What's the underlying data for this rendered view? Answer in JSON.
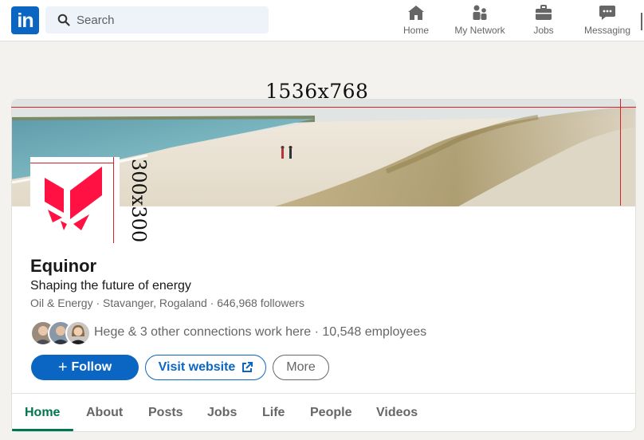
{
  "nav": {
    "logo_text": "in",
    "search_placeholder": "Search",
    "items": [
      {
        "label": "Home",
        "icon": "home-icon"
      },
      {
        "label": "My Network",
        "icon": "network-icon"
      },
      {
        "label": "Jobs",
        "icon": "briefcase-icon"
      },
      {
        "label": "Messaging",
        "icon": "messaging-icon"
      }
    ]
  },
  "annotations": {
    "banner_size": "1536x768",
    "logo_size": "300x300"
  },
  "company": {
    "name": "Equinor",
    "tagline": "Shaping the future of energy",
    "meta": "Oil & Energy · Stavanger, Rogaland · 646,968 followers",
    "connections": "Hege & 3 other connections work here · 10,548 employees"
  },
  "actions": {
    "follow_label": "Follow",
    "website_label": "Visit website",
    "more_label": "More"
  },
  "tabs": [
    "Home",
    "About",
    "Posts",
    "Jobs",
    "Life",
    "People",
    "Videos"
  ],
  "colors": {
    "brand_blue": "#0a66c2",
    "tab_active_green": "#01754f",
    "equinor_red": "#ff1243",
    "annotation_red": "#d8202a"
  }
}
